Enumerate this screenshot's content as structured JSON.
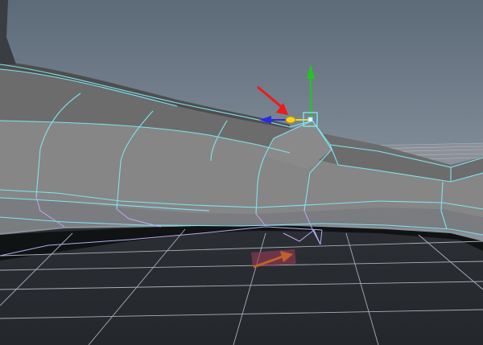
{
  "viewport": {
    "panel": "perspective-viewport",
    "background_top": "#5d6a78",
    "background_bottom": "#aab3bc",
    "colors": {
      "mesh_wire": "#7fe4ee",
      "mesh_wire_lavender": "#b9a9f0",
      "mesh_face_light": "#747474",
      "mesh_face_dark": "#505050",
      "mesh_underside": "#0f1313",
      "grid_line": "#a9aeb5",
      "floor_dark": "#262a2f",
      "gizmo_y_axis": "#1ec81e",
      "gizmo_x_axis": "#ffd21a",
      "gizmo_z_axis": "#2a2ae6",
      "selected_vertex": "#7fe4ee",
      "annotation_arrow": "#ee1a1a",
      "highlight_arrow": "#b23f4f"
    }
  },
  "move_manipulator": {
    "axes": [
      "y-axis",
      "x-axis",
      "z-axis"
    ],
    "selection": "single-vertex"
  },
  "annotations": [
    "red-arrow-to-selected-vertex",
    "red-arrow-on-floor"
  ]
}
